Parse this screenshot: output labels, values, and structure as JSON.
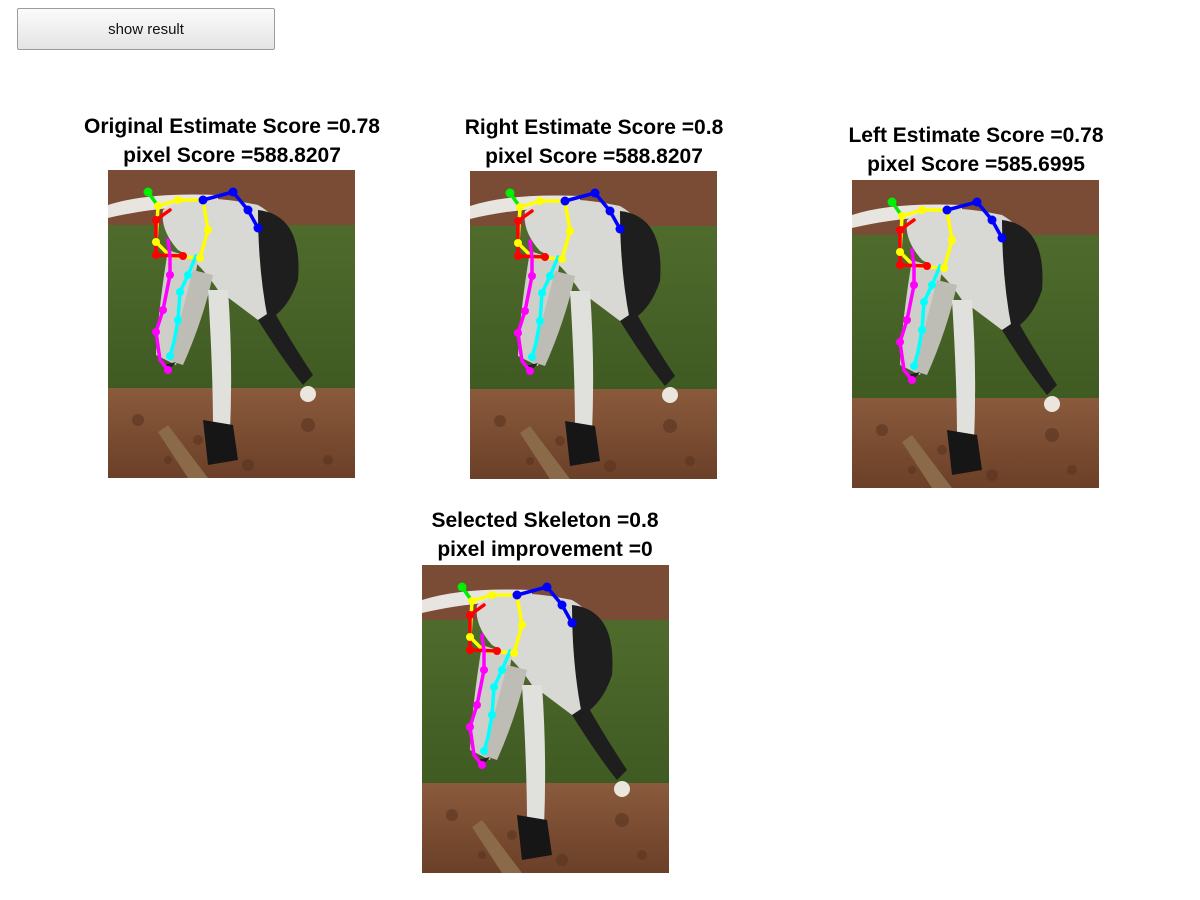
{
  "button": {
    "label": "show result"
  },
  "panels": [
    {
      "line1": "Original Estimate Score =0.78",
      "line2": "pixel Score =588.8207"
    },
    {
      "line1": "Right Estimate Score =0.8",
      "line2": "pixel Score =588.8207"
    },
    {
      "line1": "Left Estimate Score =0.78",
      "line2": "pixel Score =585.6995"
    },
    {
      "line1": "Selected Skeleton =0.8",
      "line2": "pixel improvement =0"
    }
  ],
  "skeleton_colors": {
    "head": "#00ee00",
    "torso": "#ffff00",
    "right_arm": "#0000ff",
    "left_arm": "#ff0000",
    "right_leg": "#00ffff",
    "left_leg": "#ff00ff"
  }
}
